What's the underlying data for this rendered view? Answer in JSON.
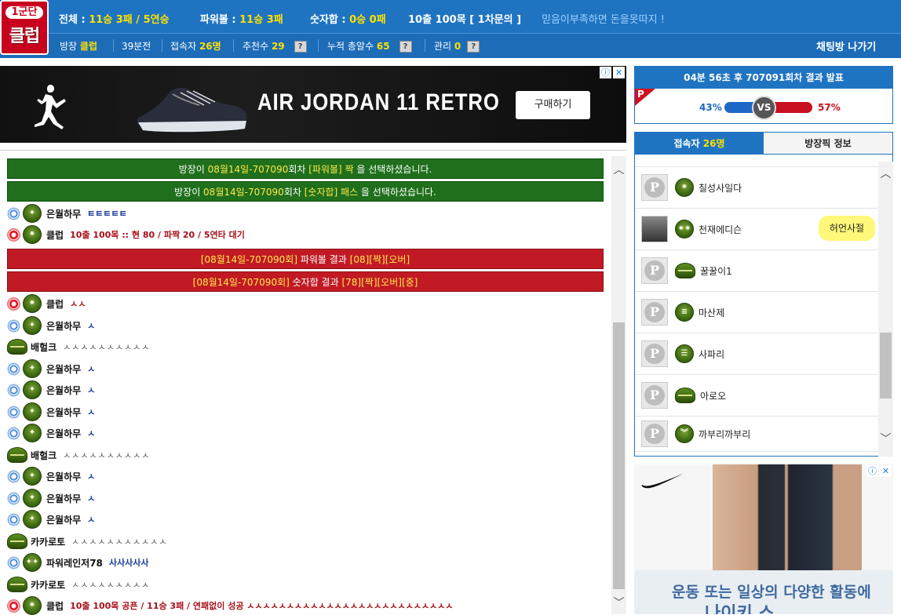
{
  "logo": {
    "top": "1군단",
    "main": "클럽"
  },
  "stats": {
    "total_label": "전체 :",
    "total_value": "11승 3패 / 5연승",
    "power_label": "파워볼 :",
    "power_value": "11승 3패",
    "number_label": "숫자합 :",
    "number_value": "0승 0패",
    "bet_info": "10출 100목 [ 1차문의 ]",
    "slogan": "믿음이부족하면 돈을못따지 !"
  },
  "room": {
    "host_label": "방장",
    "host_value": "클럽",
    "age": "39분전",
    "users_label": "접속자",
    "users_value": "26명",
    "recommend_label": "추천수",
    "recommend_value": "29",
    "total_label": "누적 총알수",
    "total_value": "65",
    "manage_label": "관리",
    "manage_value": "0",
    "help": "?",
    "exit": "채팅방 나가기"
  },
  "ad_top": {
    "title": "AIR JORDAN 11 RETRO",
    "button": "구매하기",
    "info": "ⓘ",
    "close": "✕"
  },
  "chat": {
    "green_messages": [
      {
        "pre": "방장이 ",
        "hl": "08월14일-707090",
        "mid": "회차 ",
        "hl2": "[파워볼] 짝",
        "post": " 을 선택하셨습니다."
      },
      {
        "pre": "방장이 ",
        "hl": "08월14일-707090",
        "mid": "회차 ",
        "hl2": "[숫자합] 패스",
        "post": " 을 선택하셨습니다."
      }
    ],
    "red_messages": [
      {
        "hl": "[08월14일-707090회]",
        "mid": " 파워볼 결과 ",
        "hl2": "[08][짝][오버]"
      },
      {
        "hl": "[08월14일-707090회]",
        "mid": " 숫자합 결과 ",
        "hl2": "[78][짝][오버][중]"
      }
    ],
    "rows": [
      {
        "nick": "은월하무",
        "text": "ㅌㅌㅌㅌㅌ"
      },
      {
        "nick": "클럽",
        "text": "10출 100목 :: 현 80 / 파짝 20 / 5연타 대기"
      },
      {
        "nick": "클럽",
        "text": "ㅅㅅ"
      },
      {
        "nick": "은월하무",
        "text": "ㅅ"
      },
      {
        "nick": "배헐크",
        "text": "ㅅㅅㅅㅅㅅㅅㅅㅅㅅㅅ"
      },
      {
        "nick": "은월하무",
        "text": "ㅅ"
      },
      {
        "nick": "은월하무",
        "text": "ㅅ"
      },
      {
        "nick": "은월하무",
        "text": "ㅅ"
      },
      {
        "nick": "은월하무",
        "text": "ㅅ"
      },
      {
        "nick": "배헐크",
        "text": "ㅅㅅㅅㅅㅅㅅㅅㅅㅅㅅ"
      },
      {
        "nick": "은월하무",
        "text": "ㅅ"
      },
      {
        "nick": "은월하무",
        "text": "ㅅ"
      },
      {
        "nick": "은월하무",
        "text": "ㅅ"
      },
      {
        "nick": "카카로토",
        "text": "ㅅㅅㅅㅅㅅㅅㅅㅅㅅㅅㅅ"
      },
      {
        "nick": "파워레인저78",
        "text": "사사사사사"
      },
      {
        "nick": "카카로토",
        "text": "ㅅㅅㅅㅅㅅㅅㅅㅅㅅ"
      },
      {
        "nick": "클럽",
        "text": "10출 100목 공픈 / 11승 3패 / 연패없이 성공 ㅅㅅㅅㅅㅅㅅㅅㅅㅅㅅㅅㅅㅅㅅㅅㅅㅅㅅㅅㅅㅅㅅㅅㅅㅅㅅ"
      }
    ]
  },
  "result": {
    "countdown": "04분 56초 후",
    "round": "707091회차",
    "suffix": "결과 발표",
    "flag": "P",
    "left_pct": "43%",
    "vs": "VS",
    "right_pct": "57%",
    "left_value": 43,
    "right_value": 57
  },
  "users_panel": {
    "tab_users_label": "접속자",
    "tab_users_count": "26명",
    "tab_pick": "방장픽 정보",
    "users": [
      "칠성사일다",
      "천재에디슨",
      "꿀꿀이1",
      "마산제",
      "사파리",
      "아로오",
      "까부리까부리"
    ],
    "bubble": "허언사절"
  },
  "ad_right": {
    "line1": "운동 또는 일상의 다양한 활동에",
    "line2": "나이키 스",
    "info": "ⓘ",
    "close": "✕"
  },
  "colors": {
    "header": "#1f74c2",
    "accent": "#ffe000",
    "green": "#1f6f1c",
    "red": "#c11a24"
  }
}
